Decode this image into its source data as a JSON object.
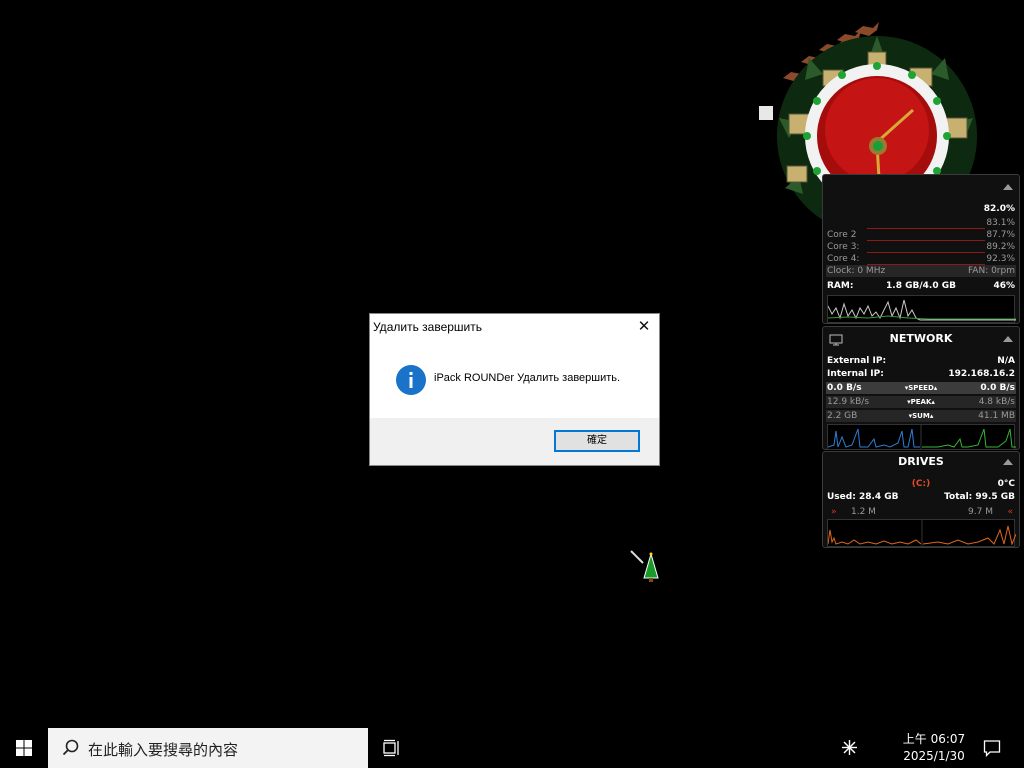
{
  "dialog": {
    "title": "Удалить завершить",
    "message": "iPack ROUNDer Удалить завершить.",
    "ok_label": "確定",
    "close_glyph": "✕",
    "icon": "info-icon",
    "accent": "#0078d7"
  },
  "cpu": {
    "total": "82.0%",
    "cores": [
      {
        "label": "",
        "value": "83.1%"
      },
      {
        "label": "Core 2",
        "value": "87.7%"
      },
      {
        "label": "Core 3:",
        "value": "89.2%"
      },
      {
        "label": "Core 4:",
        "value": "92.3%"
      }
    ],
    "clock": "Clock: 0 MHz",
    "fan": "FAN: 0rpm",
    "ram_label": "RAM:",
    "ram_value": "1.8 GB/4.0 GB",
    "ram_pct": "46%"
  },
  "network": {
    "title": "NETWORK",
    "external_label": "External IP:",
    "external_value": "N/A",
    "internal_label": "Internal IP:",
    "internal_value": "192.168.16.2",
    "speed_down": "0.0 B/s",
    "speed_label": "SPEED",
    "speed_up": "0.0 B/s",
    "peak_down": "12.9 kB/s",
    "peak_label": "PEAK",
    "peak_up": "4.8 kB/s",
    "sum_down": "2.2 GB",
    "sum_label": "SUM",
    "sum_up": "41.1 MB"
  },
  "drives": {
    "title": "DRIVES",
    "drive": "(C:)",
    "temp": "0°C",
    "used": "Used: 28.4 GB",
    "total": "Total: 99.5 GB",
    "read": "1.2 M",
    "write": "9.7 M"
  },
  "taskbar": {
    "search_placeholder": "在此輸入要搜尋的內容",
    "time": "上午 06:07",
    "date": "2025/1/30"
  }
}
